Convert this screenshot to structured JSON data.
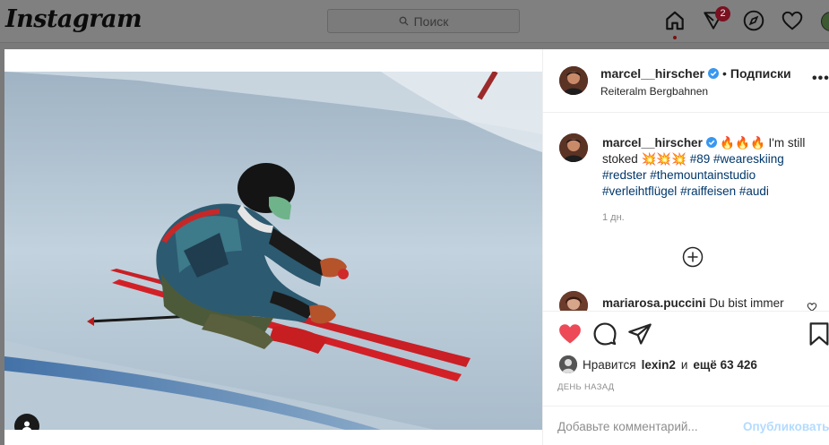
{
  "app": {
    "logo": "Instagram"
  },
  "topbar": {
    "search_placeholder": "Поиск",
    "activity_badge": "2",
    "icons": [
      "home-icon",
      "direct-icon",
      "explore-icon",
      "heart-icon",
      "avatar"
    ]
  },
  "post": {
    "author": "marcel__hirscher",
    "separator": "•",
    "follow_label": "Подписки",
    "location": "Reiteralm Bergbahnen",
    "more_label": "•••",
    "caption": {
      "author": "marcel__hirscher",
      "text_before_tags": " 🔥🔥🔥 I'm still stoked 💥💥💥 ",
      "tags": [
        "#89",
        "#weareskiing",
        "#redster",
        "#themountainstudio",
        "#verleihtflügel",
        "#raiffeisen",
        "#audi"
      ],
      "time": "1 дн."
    },
    "comments": [
      {
        "author": "mariarosa.puccini",
        "text": "Du bist immer"
      }
    ],
    "likes": {
      "prefix": "Нравится",
      "user": "lexin2",
      "conjunction": "и",
      "others": "ещё 63 426"
    },
    "date": "ДЕНЬ НАЗАД",
    "add_comment_placeholder": "Добавьте комментарий...",
    "publish_label": "Опубликовать"
  },
  "colors": {
    "like_red": "#ed4956",
    "link_blue": "#00376b",
    "publish_disabled": "#b3dbff",
    "verified_blue": "#3897f0"
  }
}
